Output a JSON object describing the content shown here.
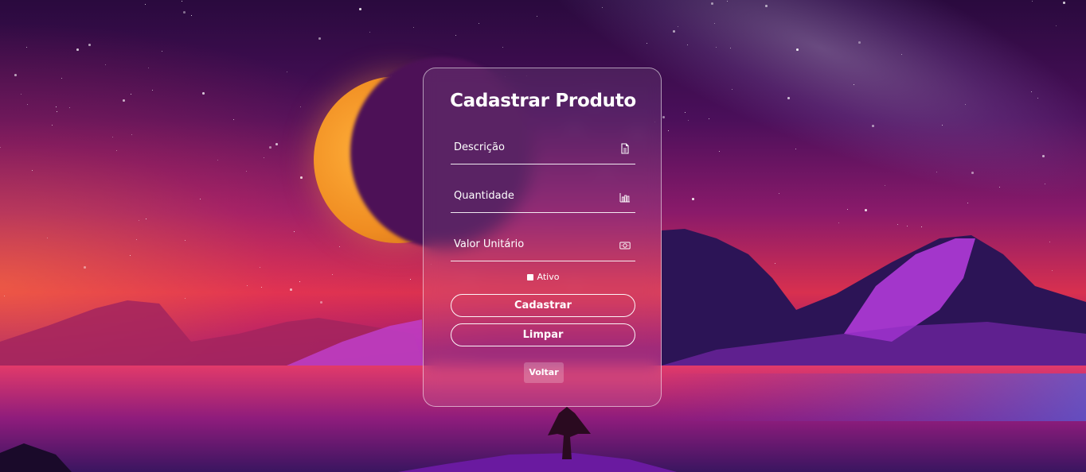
{
  "form": {
    "title": "Cadastrar Produto",
    "fields": [
      {
        "label": "Descrição",
        "icon": "document-icon"
      },
      {
        "label": "Quantidade",
        "icon": "bar-chart-icon"
      },
      {
        "label": "Valor Unitário",
        "icon": "money-icon"
      }
    ],
    "checkbox": {
      "label": "Ativo",
      "checked": false
    },
    "buttons": {
      "submit": "Cadastrar",
      "clear": "Limpar",
      "back": "Voltar"
    }
  },
  "colors": {
    "sky_top": "#2a0a3e",
    "sky_mid": "#8a1a6a",
    "horizon": "#d8304f",
    "moon": "#f08d22",
    "accent": "#ffffff"
  }
}
